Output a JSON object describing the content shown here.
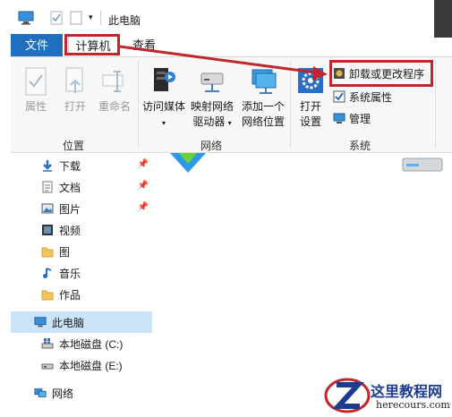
{
  "window": {
    "title": "此电脑"
  },
  "tabs": {
    "file": "文件",
    "computer": "计算机",
    "view": "查看"
  },
  "ribbon": {
    "location_group": {
      "label": "位置",
      "properties": "属性",
      "open": "打开",
      "rename": "重命名"
    },
    "network_group": {
      "label": "网络",
      "access_media": "访问媒体",
      "map_drive_line1": "映射网络",
      "map_drive_line2": "驱动器",
      "add_location_line1": "添加一个",
      "add_location_line2": "网络位置"
    },
    "system_group": {
      "label": "系统",
      "open_settings_line1": "打开",
      "open_settings_line2": "设置",
      "uninstall": "卸载或更改程序",
      "system_properties": "系统属性",
      "manage": "管理"
    }
  },
  "nav": {
    "items": [
      {
        "label": "下载",
        "icon": "download-arrow-icon",
        "pinned": true
      },
      {
        "label": "文档",
        "icon": "document-icon",
        "pinned": true
      },
      {
        "label": "图片",
        "icon": "picture-icon",
        "pinned": true
      },
      {
        "label": "视频",
        "icon": "video-icon",
        "pinned": false
      },
      {
        "label": "图",
        "icon": "folder-icon",
        "pinned": false
      },
      {
        "label": "音乐",
        "icon": "music-note-icon",
        "pinned": false
      },
      {
        "label": "作品",
        "icon": "folder-icon",
        "pinned": false
      },
      {
        "label": "此电脑",
        "icon": "computer-icon",
        "selected": true
      },
      {
        "label": "本地磁盘 (C:)",
        "icon": "windows-drive-icon"
      },
      {
        "label": "本地磁盘 (E:)",
        "icon": "drive-icon"
      },
      {
        "label": "网络",
        "icon": "network-icon"
      }
    ]
  },
  "watermark": {
    "cn": "这里教程网",
    "en": "herecours.com"
  },
  "colors": {
    "accent": "#1e6fbd",
    "highlight": "#c0272d",
    "selected": "#cce4f7"
  }
}
